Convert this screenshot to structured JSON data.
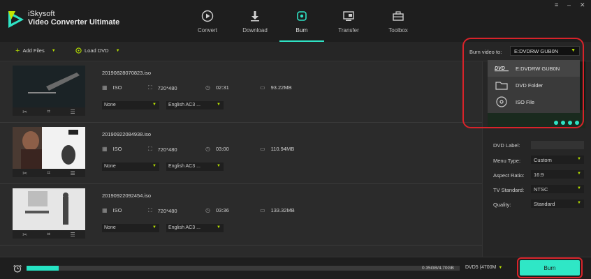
{
  "app": {
    "brand": "iSkysoft",
    "title": "Video Converter Ultimate"
  },
  "nav": [
    {
      "label": "Convert",
      "icon": "convert-icon"
    },
    {
      "label": "Download",
      "icon": "download-icon"
    },
    {
      "label": "Burn",
      "icon": "burn-icon",
      "active": true
    },
    {
      "label": "Transfer",
      "icon": "transfer-icon"
    },
    {
      "label": "Toolbox",
      "icon": "toolbox-icon"
    }
  ],
  "window": {
    "menu": "≡",
    "minimize": "–",
    "close": "✕"
  },
  "toolbar": {
    "add_files": "Add Files",
    "load_dvd": "Load DVD",
    "burn_to_label": "Burn video to:",
    "burn_to_value": "E:DVDRW  GUB0N"
  },
  "burn_menu": [
    {
      "label": "E:DVDRW  GUB0N",
      "icon": "dvd-icon"
    },
    {
      "label": "DVD Folder",
      "icon": "folder-icon"
    },
    {
      "label": "ISO File",
      "icon": "disc-icon"
    }
  ],
  "files": [
    {
      "name": "20190828070823.iso",
      "format": "ISO",
      "resolution": "720*480",
      "duration": "02:31",
      "size": "93.22MB",
      "subtitle": "None",
      "audio": "English AC3 ..."
    },
    {
      "name": "20190922084938.iso",
      "format": "ISO",
      "resolution": "720*480",
      "duration": "03:00",
      "size": "110.94MB",
      "subtitle": "None",
      "audio": "English AC3 ..."
    },
    {
      "name": "20190922092454.iso",
      "format": "ISO",
      "resolution": "720*480",
      "duration": "03:36",
      "size": "133.32MB",
      "subtitle": "None",
      "audio": "English AC3 ..."
    }
  ],
  "options": {
    "dvd_label": {
      "label": "DVD Label:",
      "value": ""
    },
    "menu_type": {
      "label": "Menu Type:",
      "value": "Custom"
    },
    "aspect_ratio": {
      "label": "Aspect Ratio:",
      "value": "16:9"
    },
    "tv_standard": {
      "label": "TV Standard:",
      "value": "NTSC"
    },
    "quality": {
      "label": "Quality:",
      "value": "Standard"
    }
  },
  "footer": {
    "progress_text": "0.35GB/4.70GB",
    "progress_fraction": 0.074,
    "disc_type": "DVD5 (4700M",
    "burn_label": "Burn"
  },
  "colors": {
    "accent": "#2fe7c6",
    "caret": "#b9e300",
    "highlight": "#d8232a"
  }
}
